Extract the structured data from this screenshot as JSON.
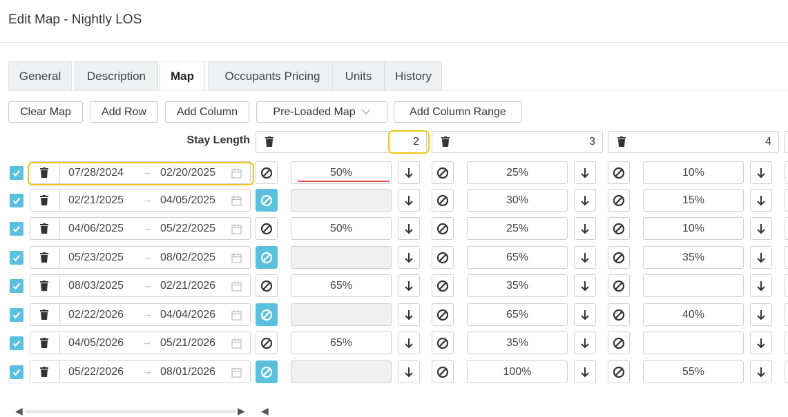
{
  "page_title": "Edit Map - Nightly LOS",
  "tabs": [
    {
      "label": "General"
    },
    {
      "label": "Description"
    },
    {
      "label": "Map",
      "active": true
    },
    {
      "label": "Occupants Pricing"
    },
    {
      "label": "Units"
    },
    {
      "label": "History"
    }
  ],
  "toolbar": {
    "clear_map": "Clear Map",
    "add_row": "Add Row",
    "add_column": "Add Column",
    "preloaded_map": "Pre-Loaded Map",
    "add_column_range": "Add Column Range"
  },
  "stay_length_label": "Stay Length",
  "columns": [
    "2",
    "3",
    "4"
  ],
  "rows": [
    {
      "checked": true,
      "start": "07/28/2024",
      "end": "02/20/2025",
      "values": [
        "50%",
        "25%",
        "10%"
      ],
      "disabled": [
        false,
        false,
        false
      ]
    },
    {
      "checked": true,
      "start": "02/21/2025",
      "end": "04/05/2025",
      "values": [
        "",
        "30%",
        "15%"
      ],
      "disabled": [
        true,
        false,
        false
      ]
    },
    {
      "checked": true,
      "start": "04/06/2025",
      "end": "05/22/2025",
      "values": [
        "50%",
        "25%",
        "10%"
      ],
      "disabled": [
        false,
        false,
        false
      ]
    },
    {
      "checked": true,
      "start": "05/23/2025",
      "end": "08/02/2025",
      "values": [
        "",
        "65%",
        "35%"
      ],
      "disabled": [
        true,
        false,
        false
      ]
    },
    {
      "checked": true,
      "start": "08/03/2025",
      "end": "02/21/2026",
      "values": [
        "65%",
        "35%",
        ""
      ],
      "disabled": [
        false,
        false,
        false
      ]
    },
    {
      "checked": true,
      "start": "02/22/2026",
      "end": "04/04/2026",
      "values": [
        "",
        "65%",
        "40%"
      ],
      "disabled": [
        true,
        false,
        false
      ]
    },
    {
      "checked": true,
      "start": "04/05/2026",
      "end": "05/21/2026",
      "values": [
        "65%",
        "35%",
        ""
      ],
      "disabled": [
        false,
        false,
        false
      ]
    },
    {
      "checked": true,
      "start": "05/22/2026",
      "end": "08/01/2026",
      "values": [
        "",
        "100%",
        "55%"
      ],
      "disabled": [
        true,
        false,
        false
      ]
    }
  ],
  "colors": {
    "accent": "#5bc0de",
    "highlight": "#f0c419",
    "underline": "#d9534f"
  }
}
